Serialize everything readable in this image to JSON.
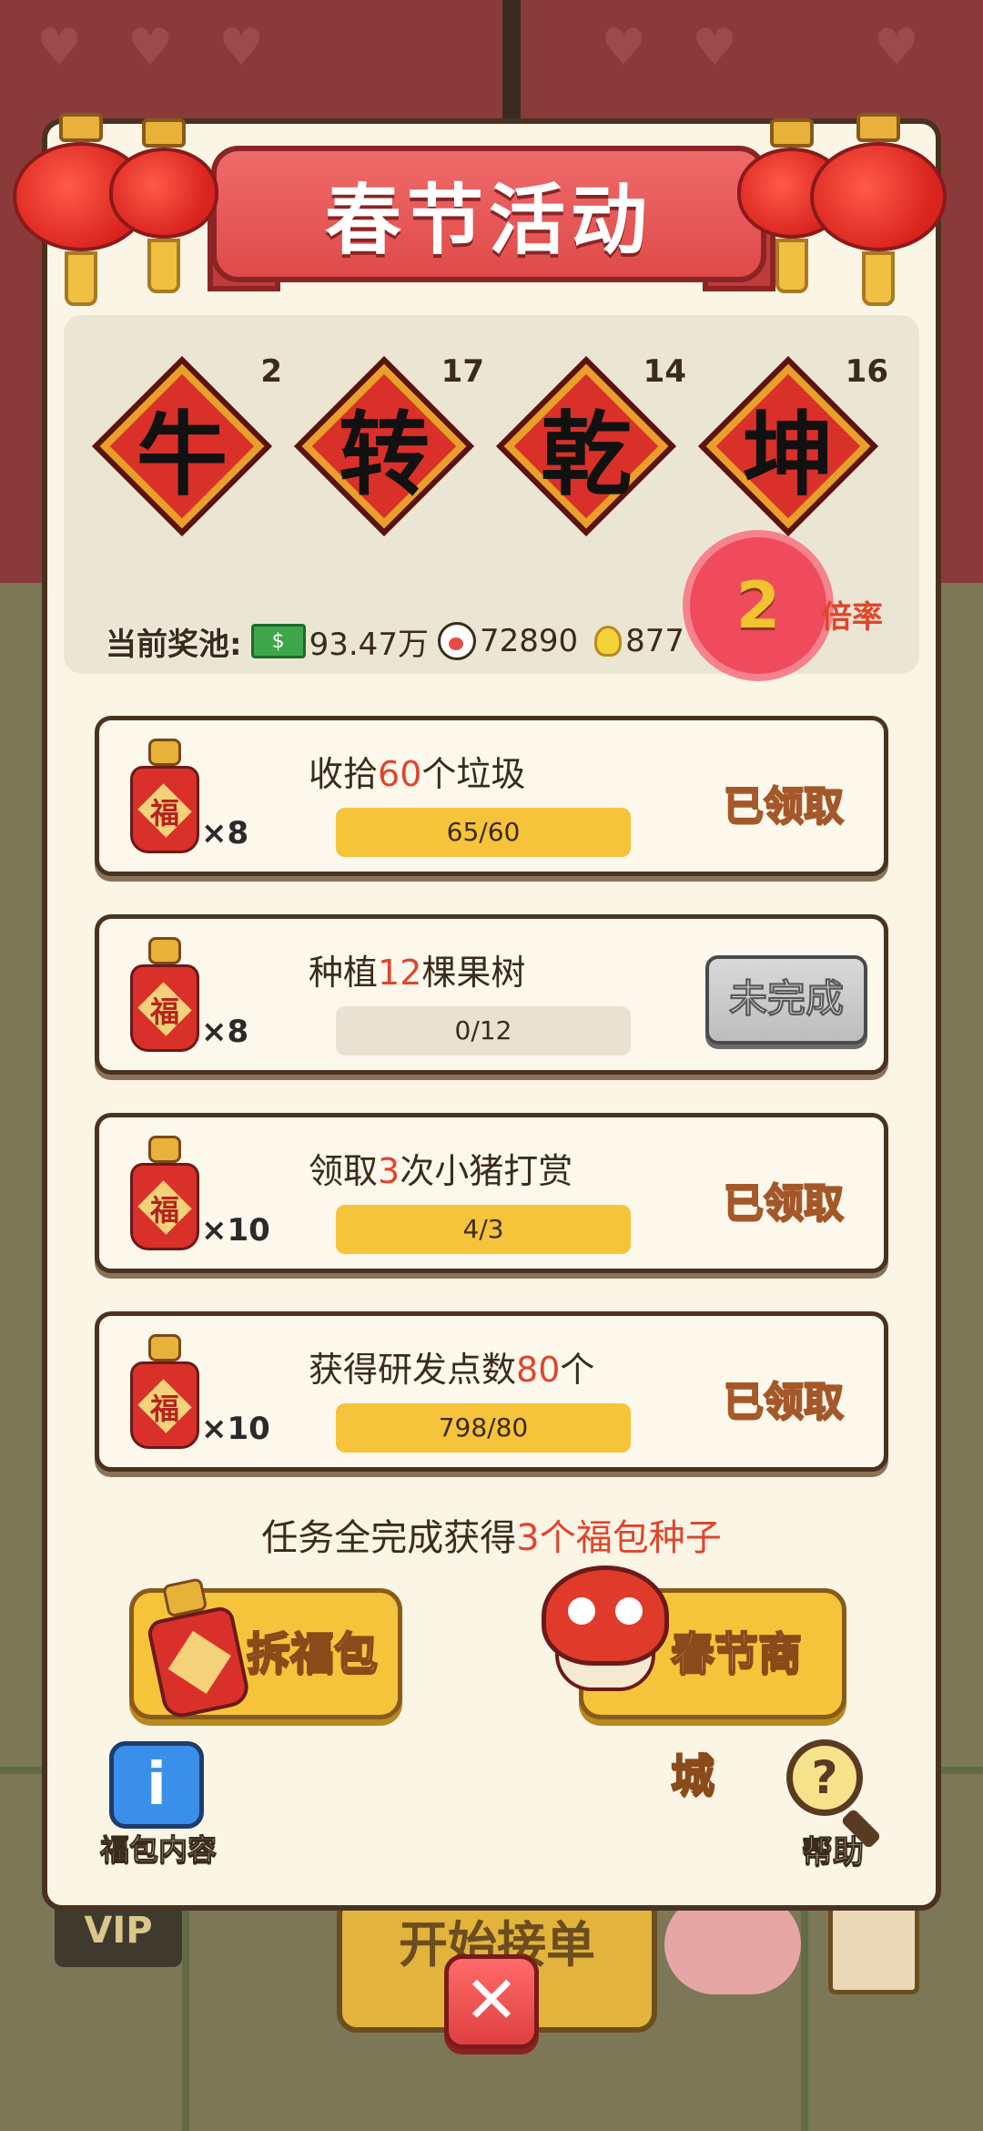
{
  "title": "春节活动",
  "characters": [
    {
      "char": "牛",
      "count": "2"
    },
    {
      "char": "转",
      "count": "17"
    },
    {
      "char": "乾",
      "count": "14"
    },
    {
      "char": "坤",
      "count": "16"
    }
  ],
  "pool": {
    "label": "当前奖池:",
    "cash": "93.47万",
    "pig_value": "72890",
    "bulb_value": "877"
  },
  "multiplier": {
    "value": "2",
    "label": "倍率"
  },
  "tasks": [
    {
      "title_pre": "收拾",
      "num": "60",
      "title_post": "个垃圾",
      "qty": "×8",
      "progress": "65/60",
      "progress_fraction": 1.0,
      "status": "已领取",
      "status_type": "claimed"
    },
    {
      "title_pre": "种植",
      "num": "12",
      "title_post": "棵果树",
      "qty": "×8",
      "progress": "0/12",
      "progress_fraction": 0.0,
      "status": "未完成",
      "status_type": "incomplete"
    },
    {
      "title_pre": "领取",
      "num": "3",
      "title_post": "次小猪打赏",
      "qty": "×10",
      "progress": "4/3",
      "progress_fraction": 1.0,
      "status": "已领取",
      "status_type": "claimed"
    },
    {
      "title_pre": "获得研发点数",
      "num": "80",
      "title_post": "个",
      "qty": "×10",
      "progress": "798/80",
      "progress_fraction": 1.0,
      "status": "已领取",
      "status_type": "claimed"
    }
  ],
  "bag_char": "福",
  "reward": {
    "pre": "任务全完成获得",
    "highlight": "3个福包种子"
  },
  "buttons": {
    "open_bag": "拆福包",
    "shop": "春节商城",
    "bag_contents": "福包内容",
    "help": "帮助"
  },
  "background": {
    "start_order": "开始接单",
    "vip": "VIP"
  },
  "colors": {
    "accent_red": "#e0462c",
    "gold": "#f6c43a",
    "panel": "#fbf5e6"
  }
}
